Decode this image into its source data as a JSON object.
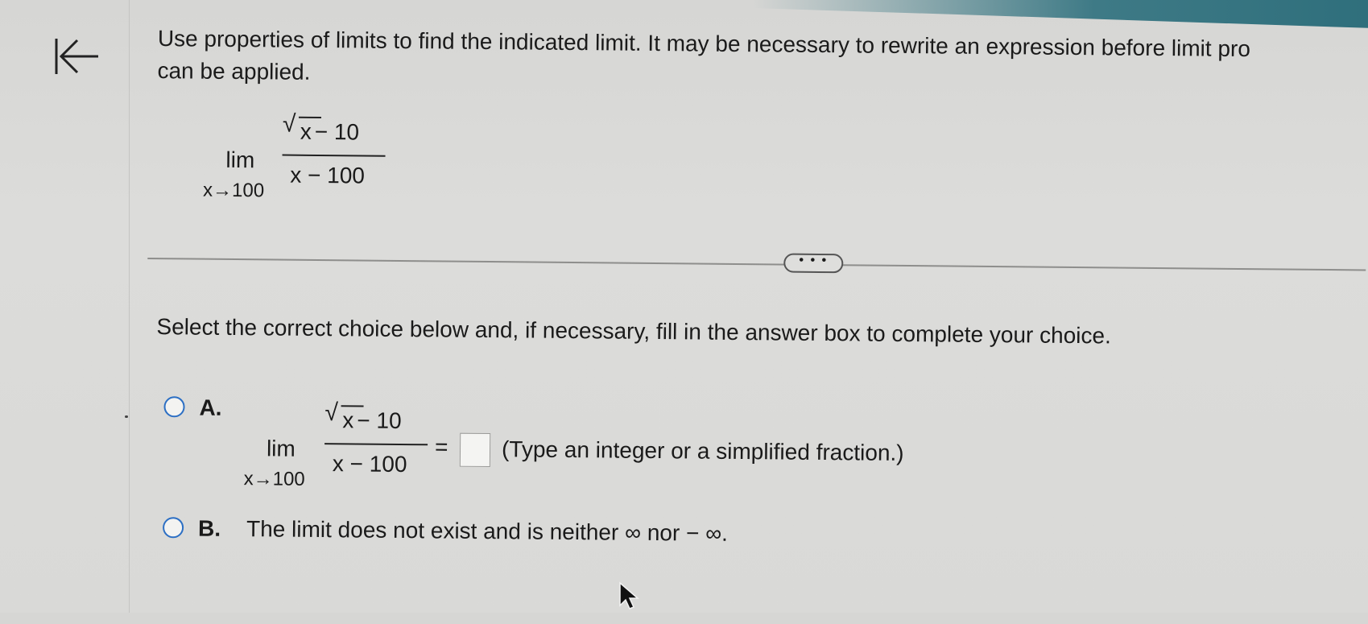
{
  "instruction": "Use properties of limits to find the indicated limit. It may be necessary to rewrite an expression before limit pro\ncan be applied.",
  "problem": {
    "lim": "lim",
    "sub": "x→100",
    "numerator_radicand": "x",
    "numerator_rest": " − 10",
    "denominator": "x − 100"
  },
  "more_button_label": "• • •",
  "select_prompt": "Select the correct choice below and, if necessary, fill in the answer box to complete your choice.",
  "choices": {
    "a": {
      "letter": "A.",
      "lim": "lim",
      "sub": "x→100",
      "numerator_radicand": "x",
      "numerator_rest": " − 10",
      "denominator": "x − 100",
      "equals": "=",
      "answer_value": "",
      "hint": "(Type an integer or a simplified fraction.)"
    },
    "b": {
      "letter": "B.",
      "text": "The limit does not exist and is neither ∞ nor − ∞."
    }
  },
  "colors": {
    "radio_border": "#2c6fc4",
    "teal": "#2f6f7c"
  }
}
